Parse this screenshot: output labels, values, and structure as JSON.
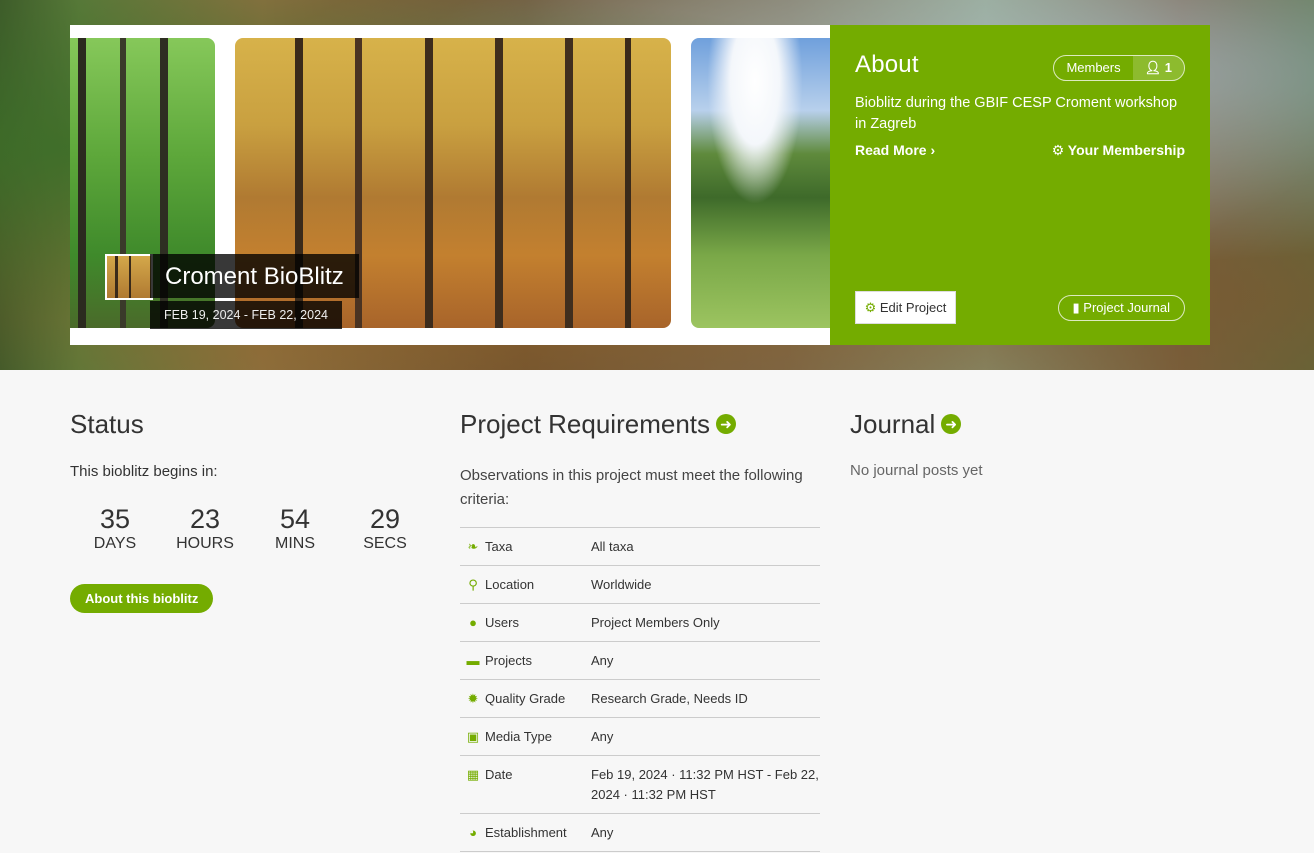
{
  "hero": {
    "title": "Croment BioBlitz",
    "dates": "FEB 19, 2024 - FEB 22, 2024"
  },
  "about": {
    "heading": "About",
    "members_label": "Members",
    "members_count": "1",
    "description": "Bioblitz during the GBIF CESP Croment workshop in Zagreb",
    "read_more": "Read More",
    "your_membership": "Your Membership",
    "edit_project": "Edit Project",
    "project_journal": "Project Journal"
  },
  "status": {
    "title": "Status",
    "begins": "This bioblitz begins in:",
    "countdown": [
      {
        "num": "35",
        "unit": "DAYS"
      },
      {
        "num": "23",
        "unit": "HOURS"
      },
      {
        "num": "54",
        "unit": "MINS"
      },
      {
        "num": "29",
        "unit": "SECS"
      }
    ],
    "about_button": "About this bioblitz"
  },
  "requirements": {
    "title": "Project Requirements",
    "intro": "Observations in this project must meet the following criteria:",
    "rows": [
      {
        "icon": "leaf-icon",
        "key": "Taxa",
        "value": "All taxa"
      },
      {
        "icon": "map-marker-icon",
        "key": "Location",
        "value": "Worldwide"
      },
      {
        "icon": "user-icon",
        "key": "Users",
        "value": "Project Members Only"
      },
      {
        "icon": "briefcase-icon",
        "key": "Projects",
        "value": "Any"
      },
      {
        "icon": "badge-icon",
        "key": "Quality Grade",
        "value": "Research Grade, Needs ID"
      },
      {
        "icon": "image-icon",
        "key": "Media Type",
        "value": "Any"
      },
      {
        "icon": "calendar-icon",
        "key": "Date",
        "value": "Feb 19, 2024 · 11:32 PM HST - Feb 22, 2024 · 11:32 PM HST"
      },
      {
        "icon": "globe-icon",
        "key": "Establishment",
        "value": "Any"
      }
    ]
  },
  "journal": {
    "title": "Journal",
    "empty": "No journal posts yet"
  },
  "colors": {
    "accent": "#74ac00"
  }
}
